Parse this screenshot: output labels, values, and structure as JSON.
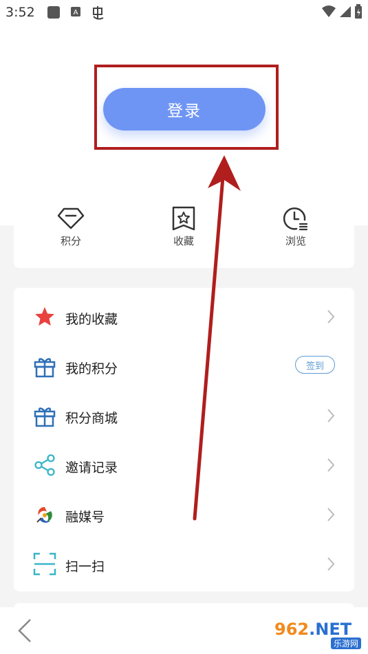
{
  "status_bar": {
    "time": "3:52",
    "icons_left": [
      "square-icon",
      "a-icon",
      "bug-icon"
    ],
    "icons_right": [
      "wifi-icon",
      "signal-icon",
      "battery-icon"
    ]
  },
  "login": {
    "button_label": "登录"
  },
  "quick_actions": [
    {
      "label": "积分",
      "icon": "diamond-icon"
    },
    {
      "label": "收藏",
      "icon": "bookmark-star-icon"
    },
    {
      "label": "浏览",
      "icon": "clock-history-icon"
    }
  ],
  "menu": {
    "items": [
      {
        "label": "我的收藏",
        "icon": "star-icon",
        "trailing": "chevron"
      },
      {
        "label": "我的积分",
        "icon": "gift-icon",
        "trailing": "badge",
        "badge": "签到"
      },
      {
        "label": "积分商城",
        "icon": "gift-icon",
        "trailing": "chevron"
      },
      {
        "label": "邀请记录",
        "icon": "share-icon",
        "trailing": "chevron"
      },
      {
        "label": "融媒号",
        "icon": "media-logo-icon",
        "trailing": "chevron"
      },
      {
        "label": "扫一扫",
        "icon": "scan-icon",
        "trailing": "chevron"
      }
    ]
  },
  "colors": {
    "accent": "#6f95f4",
    "highlight": "#b01e1e",
    "star": "#e8413e",
    "icon_blue": "#2e6fb7",
    "share_cyan": "#39b5c8"
  },
  "watermark": {
    "top": "962",
    "top_suffix": ".NET",
    "bottom": "乐游网"
  }
}
